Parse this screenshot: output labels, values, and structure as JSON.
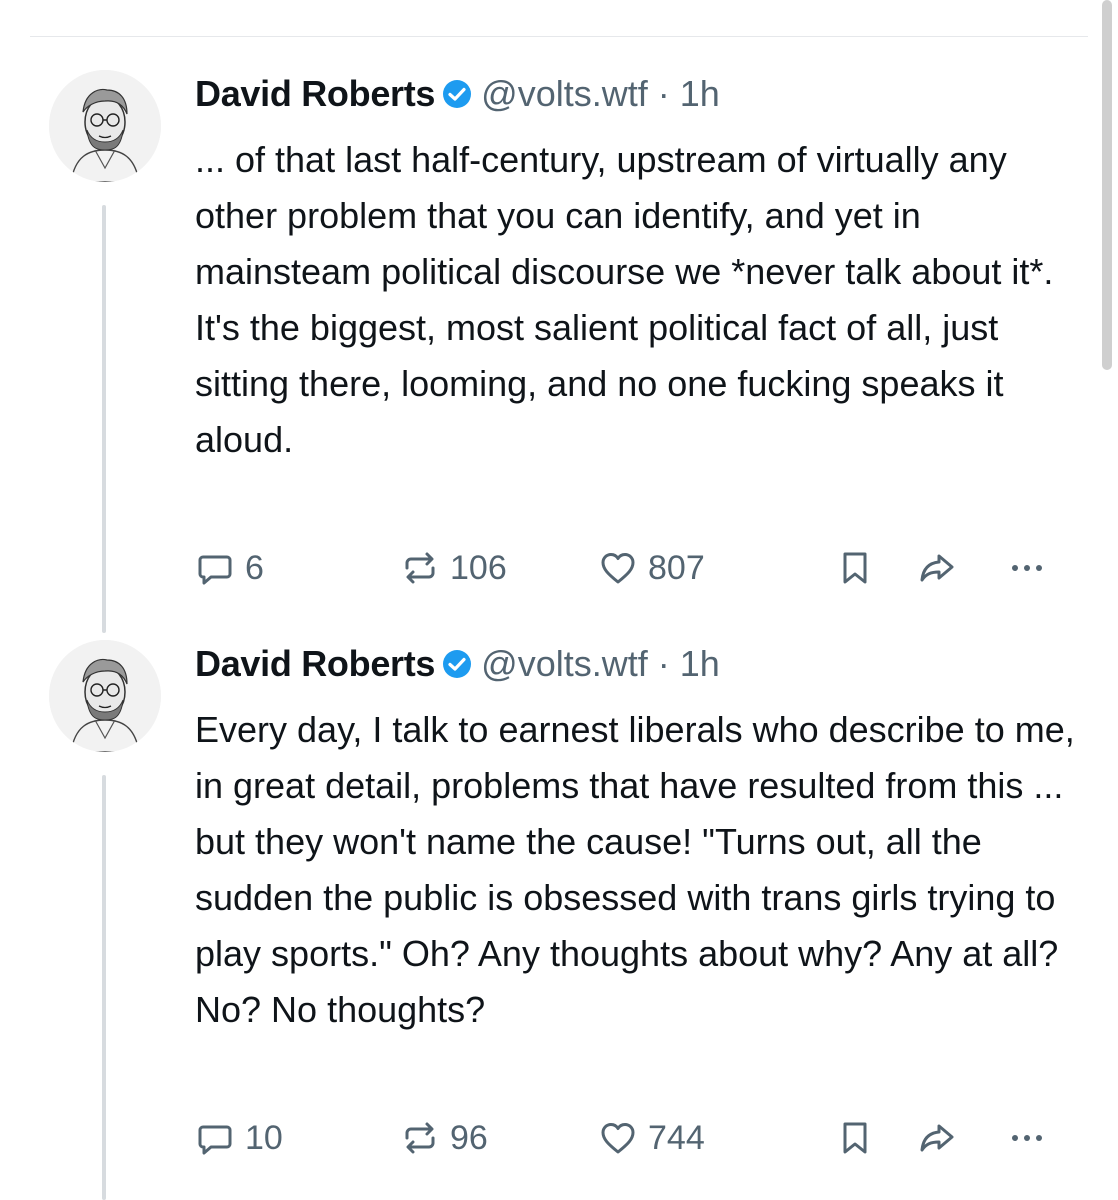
{
  "colors": {
    "text": "#0f1419",
    "secondary": "#536471",
    "verified": "#1d9bf0",
    "thread_line": "#d7dbdf"
  },
  "posts": [
    {
      "author": "David Roberts",
      "handle": "@volts.wtf",
      "separator": "·",
      "time": "1h",
      "text": "... of that last half-century, upstream of virtually any other problem that you can identify, and yet in mainsteam political discourse we *never talk about it*. It's the biggest, most salient political fact of all, just sitting there, looming, and no one fucking speaks it aloud.",
      "replies": "6",
      "reposts": "106",
      "likes": "807"
    },
    {
      "author": "David Roberts",
      "handle": "@volts.wtf",
      "separator": "·",
      "time": "1h",
      "text": "Every day, I talk to earnest liberals who describe to me, in great detail, problems that have resulted from this ... but they won't name the cause! \"Turns out, all the sudden the public is obsessed with trans girls trying to play sports.\" Oh? Any thoughts about why? Any at all? No? No thoughts?",
      "replies": "10",
      "reposts": "96",
      "likes": "744"
    }
  ],
  "icons": {
    "reply": "speech-bubble-icon",
    "repost": "repost-arrows-icon",
    "like": "heart-icon",
    "bookmark": "bookmark-icon",
    "share": "share-arrow-icon",
    "more": "ellipsis-icon",
    "verified": "verified-badge-icon"
  }
}
